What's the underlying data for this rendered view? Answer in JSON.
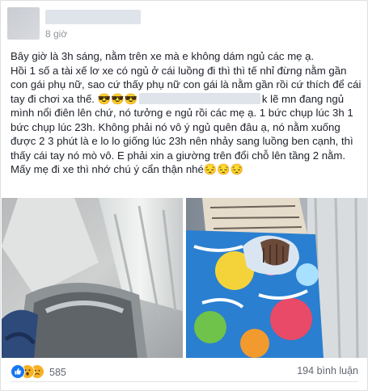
{
  "post": {
    "timestamp": "8 giờ",
    "paragraphs": {
      "p1": "Bây giờ là 3h sáng, nằm trên xe mà e không dám ngủ các mẹ ạ.",
      "p2_before": "Hồi 1 số a tài xế lơ xe có ngủ ở cái luồng đi thì thì tế nhỉ đừng nằm gần con gái phụ nữ, sao cứ thấy phụ nữ con gái là nằm gần rồi cứ thích để cái tay đi chơi xa thế. 😎😎😎",
      "p2_after": "k lẽ mn đang ngủ mình nổi điên lên chứ, nó tưởng e ngủ rồi các mẹ ạ. 1 bức chụp lúc 3h 1 bức chụp lúc 23h. Không phải nó vô ý ngủ quên đâu ạ, nó nằm xuống được 2 3 phút là e lo lo giống lúc 23h nên nhảy sang luồng ben cạnh, thì thấy cái tay nó mò vô. E phải xin a giường trên đổi chỗ lên tầng 2 nằm. Mấy mẹ đi xe thì nhớ chú ý cẩn thận nhé😔😔😔"
    }
  },
  "footer": {
    "reaction_count": "585",
    "comment_count": "194 bình luận",
    "reactions": [
      "like-icon",
      "wow-icon",
      "sad-icon"
    ]
  },
  "colors": {
    "like": "#1877f2",
    "meta_text": "#90949c",
    "redaction": "#dfe3ea"
  }
}
